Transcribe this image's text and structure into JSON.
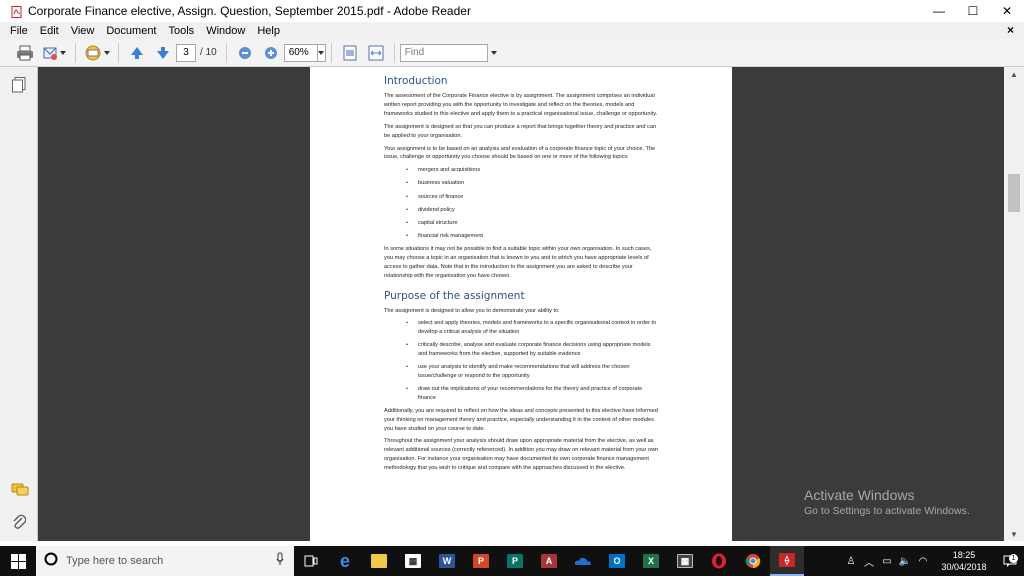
{
  "window": {
    "title": "Corporate Finance elective, Assign. Question, September 2015.pdf - Adobe Reader",
    "minimize": "—",
    "maximize": "☐",
    "close": "✕",
    "doc_close": "×"
  },
  "menu": [
    "File",
    "Edit",
    "View",
    "Document",
    "Tools",
    "Window",
    "Help"
  ],
  "toolbar": {
    "page_current": "3",
    "page_total": "/ 10",
    "zoom": "60%",
    "find_placeholder": "Find"
  },
  "document": {
    "heading1": "Introduction",
    "intro_p1": "The assessment of the Corporate Finance elective is by assignment. The assignment comprises an individual written report providing you with the opportunity to investigate and reflect on the theories, models and frameworks studied in this elective and apply them to a practical organisational issue, challenge or opportunity.",
    "intro_p2": "The assignment is designed so that you can produce a report that brings together theory and practice and can be applied to your organisation.",
    "intro_p3": "Your assignment is to be based on an analysis and evaluation of a corporate finance topic of your choice. The issue, challenge or opportunity you choose should be based on one or more of the following topics:",
    "topics": [
      "mergers and acquisitions",
      "business valuation",
      "sources of finance",
      "dividend policy",
      "capital structure",
      "financial risk management"
    ],
    "intro_p4": "In some situations it may not be possible to find a suitable topic within your own organisation. In such cases, you may choose a topic in an organisation that is known to you and to which you have appropriate levels of access to gather data. Note that in the introduction to the assignment you are asked to describe your relationship with the organisation you have chosen.",
    "heading2": "Purpose of the assignment",
    "purpose_p1": "The assignment is designed to allow you to demonstrate your ability to:",
    "purposes": [
      "select and apply theories, models and frameworks to a specific organisational context in order to develop a critical analysis of the situation",
      "critically describe, analyse and evaluate corporate finance decisions using appropriate models and frameworks from the elective, supported by suitable evidence",
      "use your analysis to identify and make recommendations that will address the chosen issue/challenge or respond to the opportunity",
      "draw out the implications of your recommendations for the theory and practice of corporate finance"
    ],
    "purpose_p2": "Additionally, you are required to reflect on how the ideas and concepts presented in this elective have informed your thinking on management theory and practice, especially understanding it in the context of other modules you have studied on your course to date.",
    "purpose_p3": "Throughout the assignment your analysis should draw upon appropriate material from the elective, as well as relevant additional sources (correctly referenced). In addition you may draw on relevant material from your own organisation. For instance your organisation may have documented its own corporate finance management methodology that you wish to critique and compare with the approaches discussed in the elective."
  },
  "watermark": {
    "line1": "Activate Windows",
    "line2": "Go to Settings to activate Windows."
  },
  "taskbar": {
    "search_placeholder": "Type here to search",
    "time": "18:25",
    "date": "30/04/2018",
    "notification_count": "1"
  }
}
